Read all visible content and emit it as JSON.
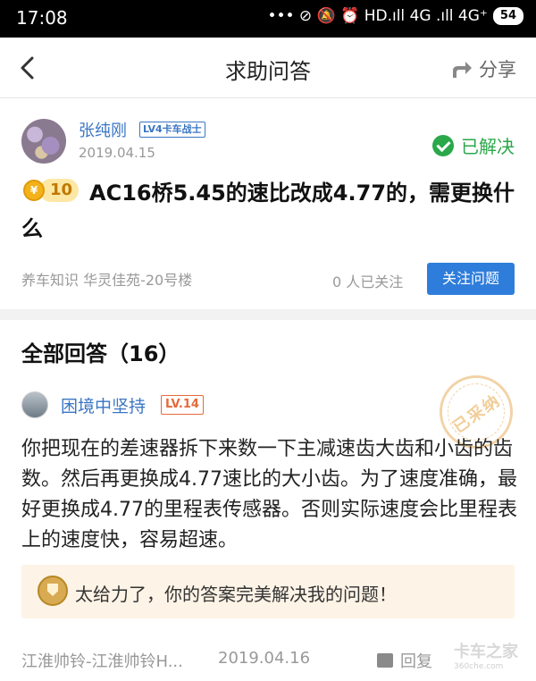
{
  "status_bar": {
    "time": "17:08",
    "icons_text": "••• ⊘ 🔕 ⏰ HD.ıll 4G .ıll 4G⁺",
    "battery": "54"
  },
  "nav": {
    "title": "求助问答",
    "share_label": "分享"
  },
  "question": {
    "user": "张纯刚",
    "level_badge": "LV4卡车战士",
    "date": "2019.04.15",
    "status": "已解决",
    "reward_icon": "¥",
    "reward": "10",
    "title": "AC16桥5.45的速比改成4.77的，需更换什么",
    "tags": "养车知识 华灵佳苑-20号楼",
    "follow_count": "0 人已关注",
    "follow_button": "关注问题"
  },
  "answers": {
    "heading": "全部回答（16）",
    "items": [
      {
        "user": "困境中坚持",
        "level": "LV.14",
        "stamp": "已采纳",
        "body": "你把现在的差速器拆下来数一下主减速齿大齿和小齿的齿数。然后再更换成4.77速比的大小齿。为了速度准确，最好更换成4.77的里程表传感器。否则实际速度会比里程表上的速度快，容易超速。",
        "praise": "太给力了，你的答案完美解决我的问题！",
        "source": "江淮帅铃-江淮帅铃H...",
        "date": "2019.04.16",
        "reply_label": "回复"
      }
    ]
  },
  "watermark": {
    "brand": "卡车之家",
    "site": "360che.com"
  },
  "colors": {
    "link_blue": "#3a76c4",
    "button_blue": "#2f7ddb",
    "solved_green": "#2aa84a",
    "praise_bg": "#fdf3e6"
  }
}
